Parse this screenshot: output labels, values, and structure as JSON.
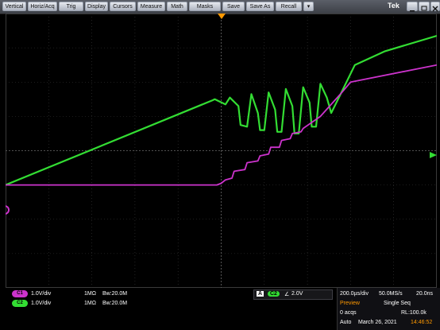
{
  "menu": {
    "items": [
      "Vertical",
      "Horiz/Acq",
      "Trig",
      "Display",
      "Cursors",
      "Measure",
      "Math",
      "Masks",
      "Save",
      "Save As",
      "Recall"
    ],
    "dropdown_glyph": "▾",
    "brand": "Tek"
  },
  "window_controls": [
    "minimize-icon",
    "maximize-icon",
    "close-icon"
  ],
  "screen": {
    "grid": {
      "h_divisions": 10,
      "v_divisions": 8,
      "color": "#3a3a3a"
    },
    "markers": {
      "trigger_position_icon": "down-triangle-icon",
      "trigger_level_icon": "left-arrow-icon",
      "ground_marker_icon": "circle-marker-icon"
    },
    "colors": {
      "ch1": "#cc33cc",
      "ch2": "#33dd33",
      "trigger": "#ff9900"
    }
  },
  "chart_data": {
    "type": "line",
    "x_divisions": [
      0,
      10
    ],
    "y_divisions": [
      -4,
      4
    ],
    "series": [
      {
        "id": "C2",
        "color": "#33dd33",
        "points": [
          [
            0,
            -1.0
          ],
          [
            4.8,
            1.47
          ],
          [
            4.85,
            1.5
          ],
          [
            5.1,
            1.35
          ],
          [
            5.2,
            1.55
          ],
          [
            5.4,
            1.3
          ],
          [
            5.45,
            0.75
          ],
          [
            5.6,
            0.7
          ],
          [
            5.7,
            1.65
          ],
          [
            5.85,
            1.1
          ],
          [
            5.9,
            0.6
          ],
          [
            6.0,
            0.6
          ],
          [
            6.1,
            1.7
          ],
          [
            6.25,
            1.2
          ],
          [
            6.3,
            0.55
          ],
          [
            6.4,
            0.55
          ],
          [
            6.5,
            1.8
          ],
          [
            6.65,
            1.3
          ],
          [
            6.7,
            0.5
          ],
          [
            6.8,
            0.5
          ],
          [
            6.9,
            1.85
          ],
          [
            7.05,
            1.4
          ],
          [
            7.1,
            0.7
          ],
          [
            7.2,
            0.7
          ],
          [
            7.3,
            1.95
          ],
          [
            7.45,
            1.55
          ],
          [
            7.55,
            1.1
          ],
          [
            7.75,
            1.6
          ],
          [
            8.1,
            2.5
          ],
          [
            8.8,
            2.9
          ],
          [
            10,
            3.35
          ]
        ]
      },
      {
        "id": "C1",
        "color": "#cc33cc",
        "points": [
          [
            0,
            -1.0
          ],
          [
            4.9,
            -1.0
          ],
          [
            5.0,
            -0.95
          ],
          [
            5.1,
            -0.85
          ],
          [
            5.25,
            -0.8
          ],
          [
            5.3,
            -0.6
          ],
          [
            5.55,
            -0.55
          ],
          [
            5.6,
            -0.35
          ],
          [
            5.85,
            -0.3
          ],
          [
            5.9,
            -0.15
          ],
          [
            6.1,
            -0.1
          ],
          [
            6.15,
            0.1
          ],
          [
            6.35,
            0.1
          ],
          [
            6.4,
            0.3
          ],
          [
            6.6,
            0.35
          ],
          [
            6.65,
            0.5
          ],
          [
            6.85,
            0.55
          ],
          [
            6.9,
            0.65
          ],
          [
            7.3,
            1.0
          ],
          [
            7.8,
            1.7
          ],
          [
            8.0,
            2.0
          ],
          [
            10,
            2.5
          ]
        ]
      }
    ]
  },
  "status": {
    "channels": [
      {
        "badge": "C1",
        "scale": "1.0V/div",
        "impedance": "1MΩ",
        "bandwidth": "Bᴡ:20.0M",
        "color": "#cc33cc"
      },
      {
        "badge": "C2",
        "scale": "1.0V/div",
        "impedance": "1MΩ",
        "bandwidth": "Bᴡ:20.0M",
        "color": "#33dd33"
      }
    ],
    "trigger": {
      "label": "A",
      "source": "C2",
      "slope_glyph": "∠",
      "level": "2.0V"
    },
    "acquisition": {
      "timebase": "200.0µs/div",
      "sample_rate": "50.0MS/s",
      "sample_interval": "20.0ns",
      "mode_label": "Preview",
      "mode": "Single Seq",
      "acqs": "0 acqs",
      "record_length": "RL:100.0k",
      "run": "Auto",
      "date": "March 26, 2021",
      "time": "14:46:52"
    }
  }
}
